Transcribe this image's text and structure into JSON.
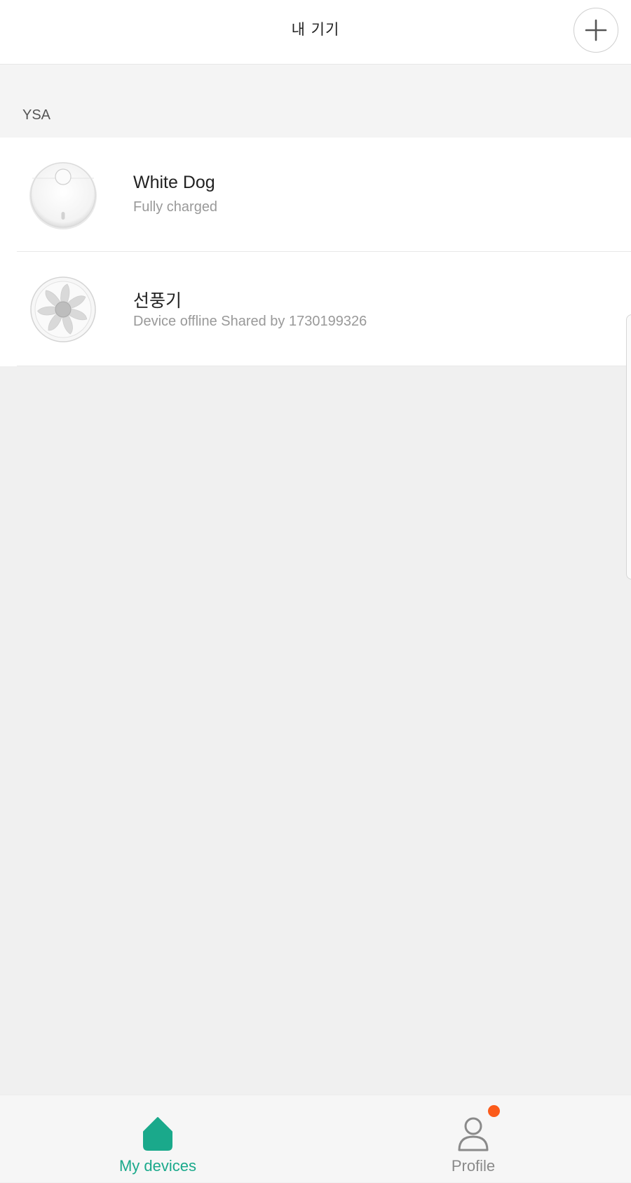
{
  "header": {
    "title": "내 기기",
    "add_icon": "plus-icon"
  },
  "section": {
    "label": "YSA"
  },
  "devices": [
    {
      "name": "White Dog",
      "status": "Fully charged",
      "icon": "robot-vacuum-icon"
    },
    {
      "name": "선풍기",
      "status": "Device offline Shared by 1730199326",
      "icon": "fan-icon"
    }
  ],
  "bottom_nav": {
    "tabs": [
      {
        "label": "My devices",
        "icon": "home-icon",
        "active": true
      },
      {
        "label": "Profile",
        "icon": "person-icon",
        "active": false,
        "badge": true
      }
    ]
  },
  "colors": {
    "accent": "#1aa98b",
    "inactive": "#8a8a8a",
    "badge": "#fb5b1b",
    "background": "#f0f0f0"
  }
}
